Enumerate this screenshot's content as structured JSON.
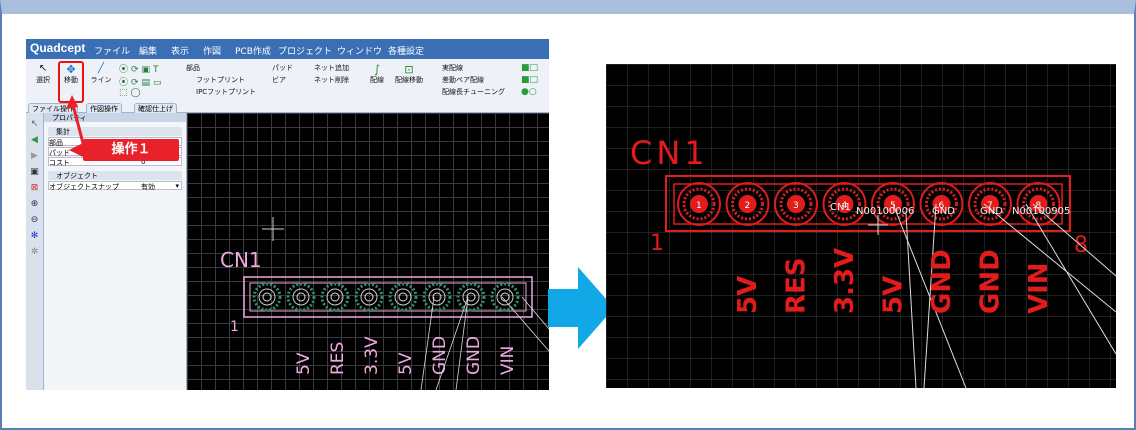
{
  "app": {
    "logo": "Quadcept",
    "menu": [
      "ファイル",
      "編集",
      "表示",
      "作図",
      "PCB作成",
      "プロジェクト",
      "ウィンドウ",
      "各種設定"
    ],
    "ribbon": {
      "select": "選択",
      "move": "移動",
      "line": "ライン",
      "part": "部品",
      "footprint": "フットプリント",
      "ipc_footprint": "IPCフットプリント",
      "pad": "パッド",
      "via": "ビア",
      "net_add": "ネット追加",
      "net_delete": "ネット削除",
      "routing": "配線",
      "route_move": "配線移動",
      "actual_route": "実配線",
      "diff_pair": "差動ペア配線",
      "length_tuning": "配線長チューニング"
    },
    "tabs": [
      "ファイル操作",
      "作図操作",
      "確認仕上げ"
    ],
    "properties": {
      "title": "プロパティ",
      "section_summary": "集計",
      "rows": [
        {
          "label": "部品",
          "value": ""
        },
        {
          "label": "パッド",
          "value": ""
        },
        {
          "label": "コスト",
          "value": "0"
        }
      ],
      "section_object": "オブジェクト",
      "snap_label": "オブジェクトスナップ",
      "snap_value": "有効"
    },
    "callout": "操作１"
  },
  "pcb": {
    "designator": "CN1",
    "pin_first": "1",
    "pin_last": "8",
    "pins": [
      "1",
      "2",
      "3",
      "4",
      "5",
      "6",
      "7",
      "8"
    ],
    "net_labels": [
      "5V",
      "RES",
      "3.3V",
      "5V",
      "GND",
      "GND",
      "VIN"
    ],
    "net_name_a": "N00100006",
    "net_name_b": "GND",
    "net_name_c": "GND",
    "net_name_d": "N00100905",
    "net_text_4": "CN1",
    "colors": {
      "left_component": "#f0a8e0",
      "left_pad": "#2f8f6a",
      "right_component": "#e21b1b",
      "ratsnest": "#dddddd",
      "arrow": "#12a8e8"
    }
  }
}
